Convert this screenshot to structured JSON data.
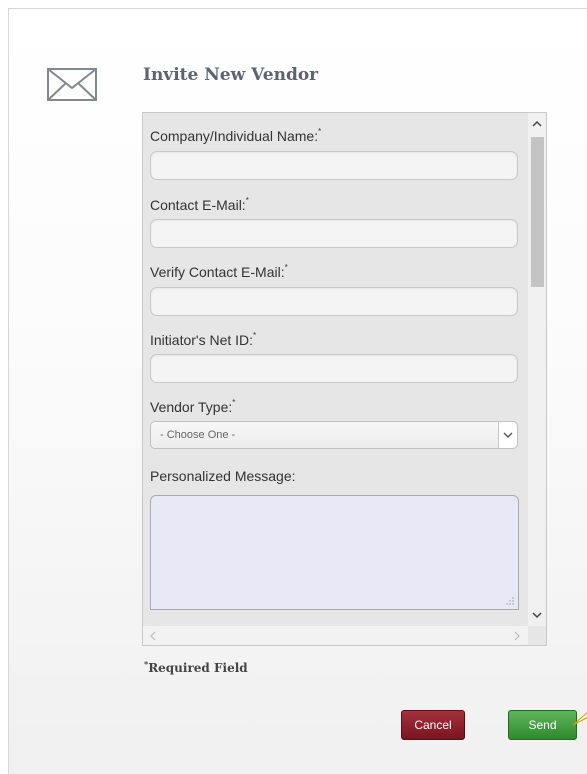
{
  "dialog": {
    "title": "Invite New Vendor",
    "icon": "envelope-icon"
  },
  "form": {
    "fields": [
      {
        "label": "Company/Individual Name:",
        "required_mark": "*",
        "value": ""
      },
      {
        "label": "Contact E-Mail:",
        "required_mark": "*",
        "value": ""
      },
      {
        "label": "Verify Contact E-Mail:",
        "required_mark": "*",
        "value": ""
      },
      {
        "label": "Initiator's Net ID:",
        "required_mark": "*",
        "value": ""
      }
    ],
    "vendor_type": {
      "label": "Vendor Type:",
      "required_mark": "*",
      "selected": "- Choose One -"
    },
    "message": {
      "label": "Personalized Message:",
      "value": ""
    }
  },
  "footer": {
    "required_mark": "*",
    "required_note": "Required Field",
    "cancel_label": "Cancel",
    "send_label": "Send"
  },
  "colors": {
    "cancel": "#8b1e2a",
    "send": "#3d9a3a",
    "title": "#5a6470",
    "textarea_bg": "#e8e8f6",
    "callout": "#ffffcc"
  }
}
